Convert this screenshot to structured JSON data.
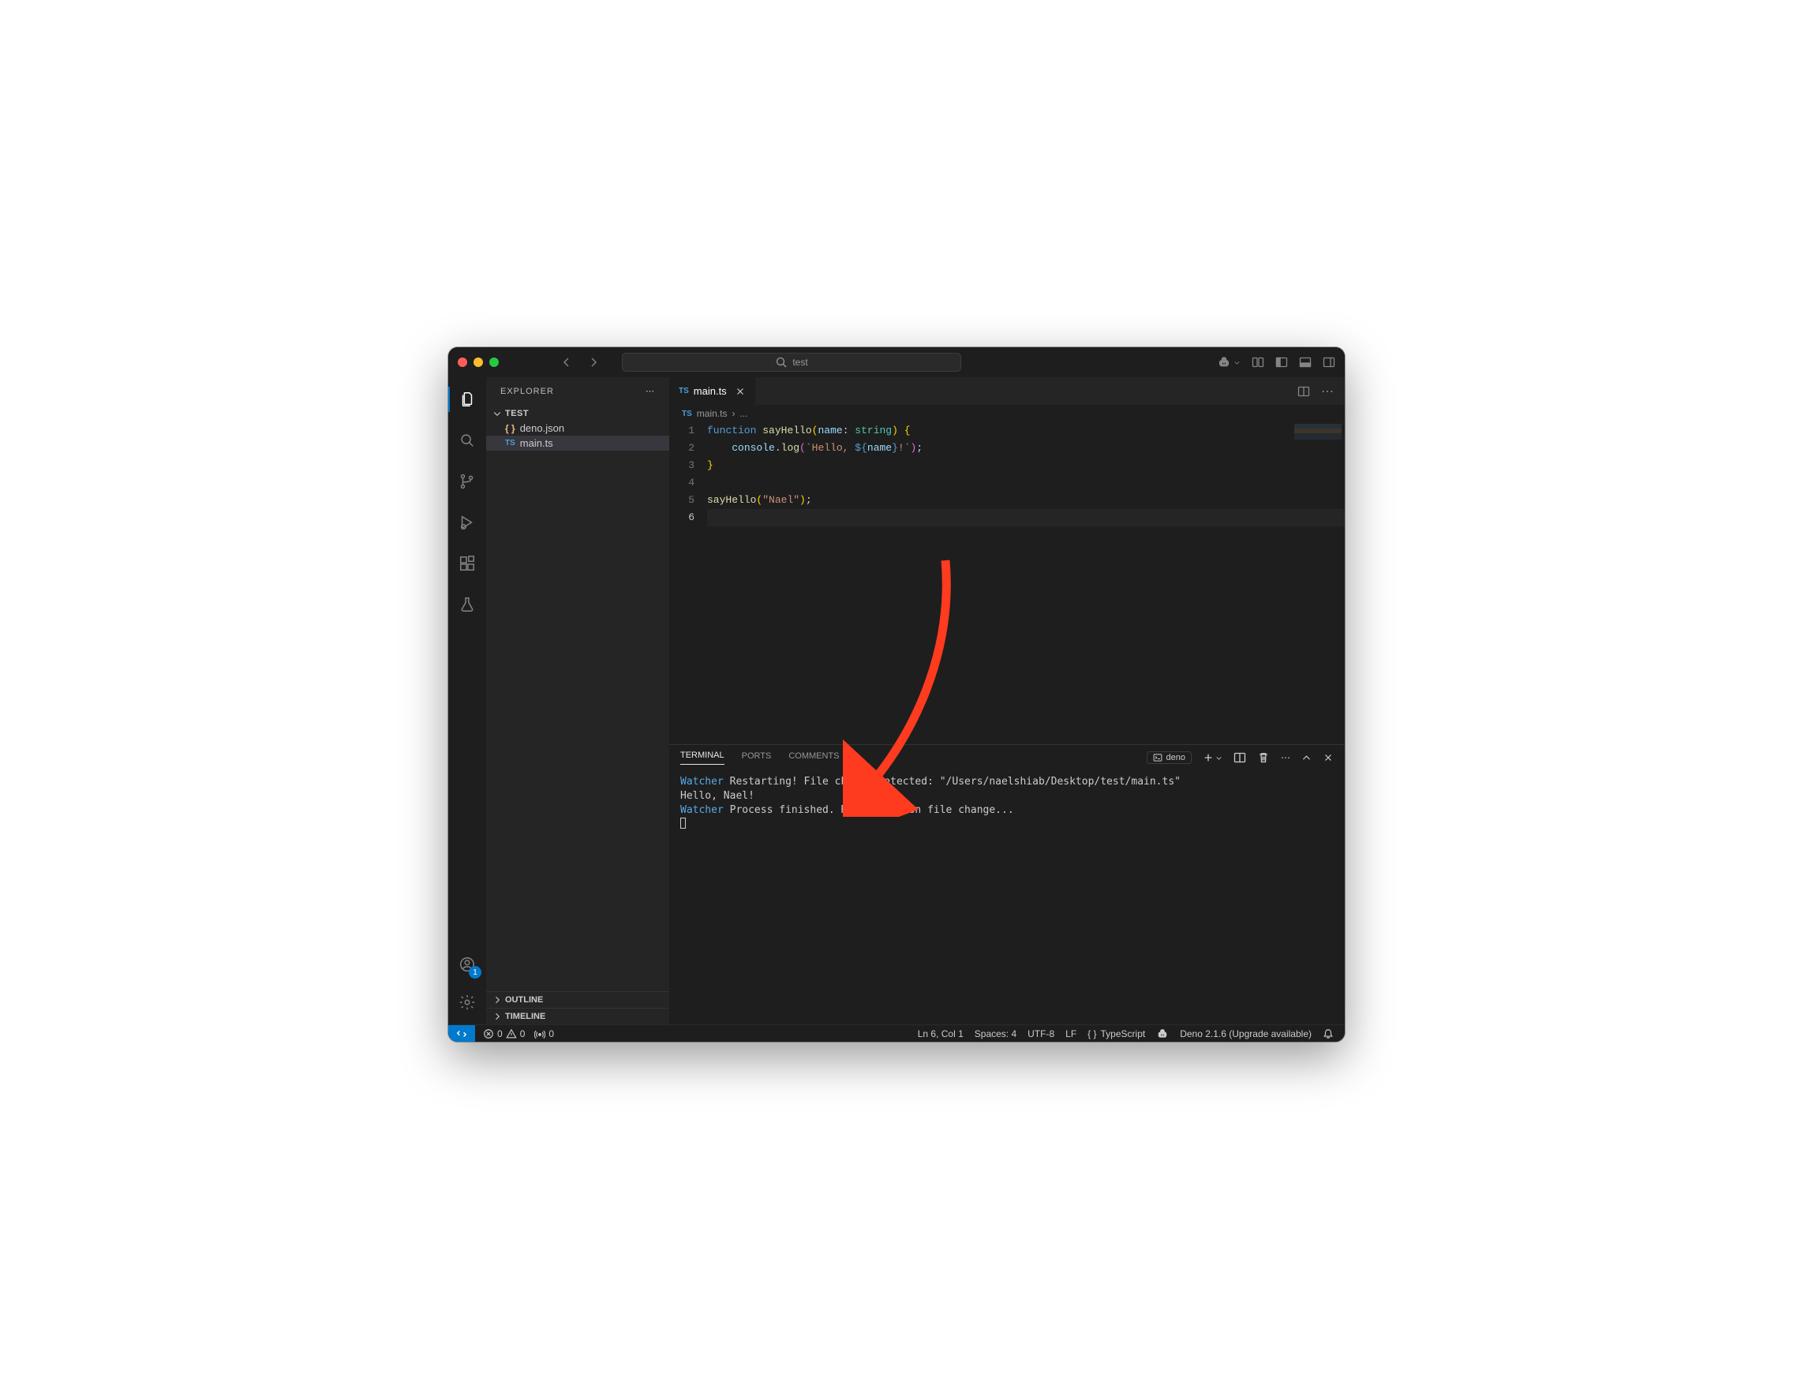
{
  "titlebar": {
    "search": "test"
  },
  "sidebar": {
    "title": "EXPLORER",
    "root": "TEST",
    "files": [
      {
        "icon": "brace",
        "name": "deno.json"
      },
      {
        "icon": "ts",
        "name": "main.ts",
        "selected": true
      }
    ],
    "outline": "OUTLINE",
    "timeline": "TIMELINE"
  },
  "tabs": {
    "active": {
      "icon": "TS",
      "name": "main.ts"
    }
  },
  "breadcrumb": {
    "icon": "TS",
    "file": "main.ts",
    "sep": "›",
    "ellipsis": "..."
  },
  "code": {
    "lines": [
      "1",
      "2",
      "3",
      "4",
      "5",
      "6"
    ],
    "l1": {
      "kw": "function",
      "fn": "sayHello",
      "lp": "(",
      "var": "name",
      "colon": ": ",
      "type": "string",
      "rp": ") ",
      "brace": "{"
    },
    "l2": {
      "indent": "    ",
      "obj": "console",
      "dot": ".",
      "method": "log",
      "lp": "(",
      "bt1": "`",
      "str": "Hello, ",
      "tmplO": "${",
      "var": "name",
      "tmplC": "}",
      "str2": "!",
      "bt2": "`",
      "rp": ")",
      "semi": ";"
    },
    "l3": {
      "brace": "}"
    },
    "l5": {
      "fn": "sayHello",
      "lp": "(",
      "str": "\"Nael\"",
      "rp": ")",
      "semi": ";"
    }
  },
  "panel": {
    "tabs": {
      "terminal": "TERMINAL",
      "ports": "PORTS",
      "comments": "COMMENTS"
    },
    "termName": "deno",
    "term": {
      "watcher": "Watcher",
      "restart": "Restarting! File change detected: ",
      "file": "\"/Users/naelshiab/Desktop/test/main.ts\"",
      "hello": "Hello, Nael!",
      "finished": "Process finished. Restarting on file change..."
    }
  },
  "status": {
    "errors": "0",
    "warnings": "0",
    "radio": "0",
    "lncol": "Ln 6, Col 1",
    "spaces": "Spaces: 4",
    "encoding": "UTF-8",
    "eol": "LF",
    "lang": "TypeScript",
    "deno": "Deno 2.1.6 (Upgrade available)"
  },
  "accountBadge": "1"
}
